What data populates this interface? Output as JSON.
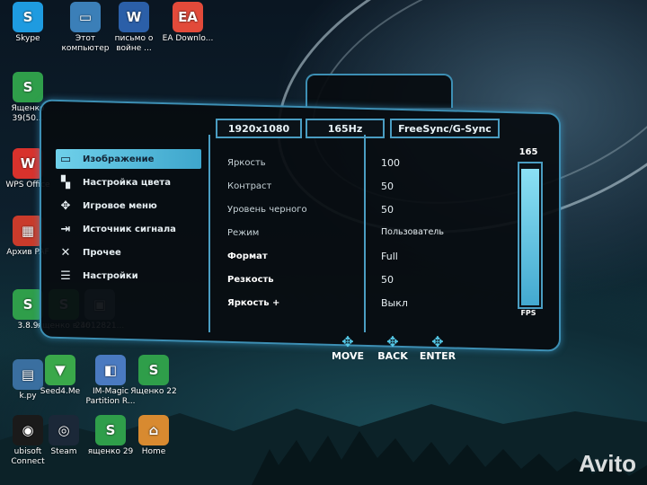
{
  "desktop": {
    "icons": [
      {
        "label": "Skype",
        "glyph": "S",
        "color": "#1e9be0"
      },
      {
        "label": "Этот компьютер",
        "glyph": "▭",
        "color": "#3b7fb8"
      },
      {
        "label": "письмо о войне ...",
        "glyph": "W",
        "color": "#2b5fa8"
      },
      {
        "label": "EA Downlo...",
        "glyph": "EA",
        "color": "#e24a3a"
      },
      {
        "label": "Ященко 39(50...",
        "glyph": "S",
        "color": "#2f9e4a"
      },
      {
        "label": "WPS Office",
        "glyph": "W",
        "color": "#d8322c"
      },
      {
        "label": "Архив PAF",
        "glyph": "▦",
        "color": "#c93b2b"
      },
      {
        "label": "3.8.9",
        "glyph": "S",
        "color": "#2f9e4a"
      },
      {
        "label": "ященко в 36",
        "glyph": "S",
        "color": "#2f9e4a"
      },
      {
        "label": "24012821...",
        "glyph": "▣",
        "color": "#5a7080"
      },
      {
        "label": "k.py",
        "glyph": "▤",
        "color": "#3a6fa0"
      },
      {
        "label": "Seed4.Me",
        "glyph": "▼",
        "color": "#3aa84a"
      },
      {
        "label": "IM-Magic Partition R...",
        "glyph": "◧",
        "color": "#4a7ac0"
      },
      {
        "label": "Ященко 22",
        "glyph": "S",
        "color": "#2f9e4a"
      },
      {
        "label": "ubisoft Connect",
        "glyph": "◉",
        "color": "#1a1a1a"
      },
      {
        "label": "Steam",
        "glyph": "◎",
        "color": "#1b2838"
      },
      {
        "label": "ященко 29",
        "glyph": "S",
        "color": "#2f9e4a"
      },
      {
        "label": "Home",
        "glyph": "⌂",
        "color": "#d88a30"
      }
    ],
    "watermark": "Avito"
  },
  "osd": {
    "resolution": "1920x1080",
    "refresh": "165Hz",
    "sync": "FreeSync/G-Sync",
    "menu": [
      {
        "label": "Изображение",
        "icon": "monitor-icon",
        "glyph": "▭",
        "selected": true
      },
      {
        "label": "Настройка цвета",
        "icon": "palette-icon",
        "glyph": "▚",
        "selected": false
      },
      {
        "label": "Игровое меню",
        "icon": "gamepad-icon",
        "glyph": "✥",
        "selected": false
      },
      {
        "label": "Источник сигнала",
        "icon": "input-icon",
        "glyph": "⇥",
        "selected": false
      },
      {
        "label": "Прочее",
        "icon": "tools-icon",
        "glyph": "✕",
        "selected": false
      },
      {
        "label": "Настройки",
        "icon": "sliders-icon",
        "glyph": "☰",
        "selected": false
      }
    ],
    "settings": [
      {
        "label": "Яркость",
        "value": "100"
      },
      {
        "label": "Контраст",
        "value": "50"
      },
      {
        "label": "Уровень черного",
        "value": "50"
      },
      {
        "label": "Режим",
        "value": "Пользователь"
      },
      {
        "label": "Формат",
        "value": "Full"
      },
      {
        "label": "Резкость",
        "value": "50"
      },
      {
        "label": "Яркость +",
        "value": "Выкл"
      }
    ],
    "fps_value": "165",
    "fps_label": "FPS",
    "fps_level": 0.95,
    "nav": [
      "MOVE",
      "BACK",
      "ENTER"
    ],
    "accent": "#4a9dc2"
  }
}
